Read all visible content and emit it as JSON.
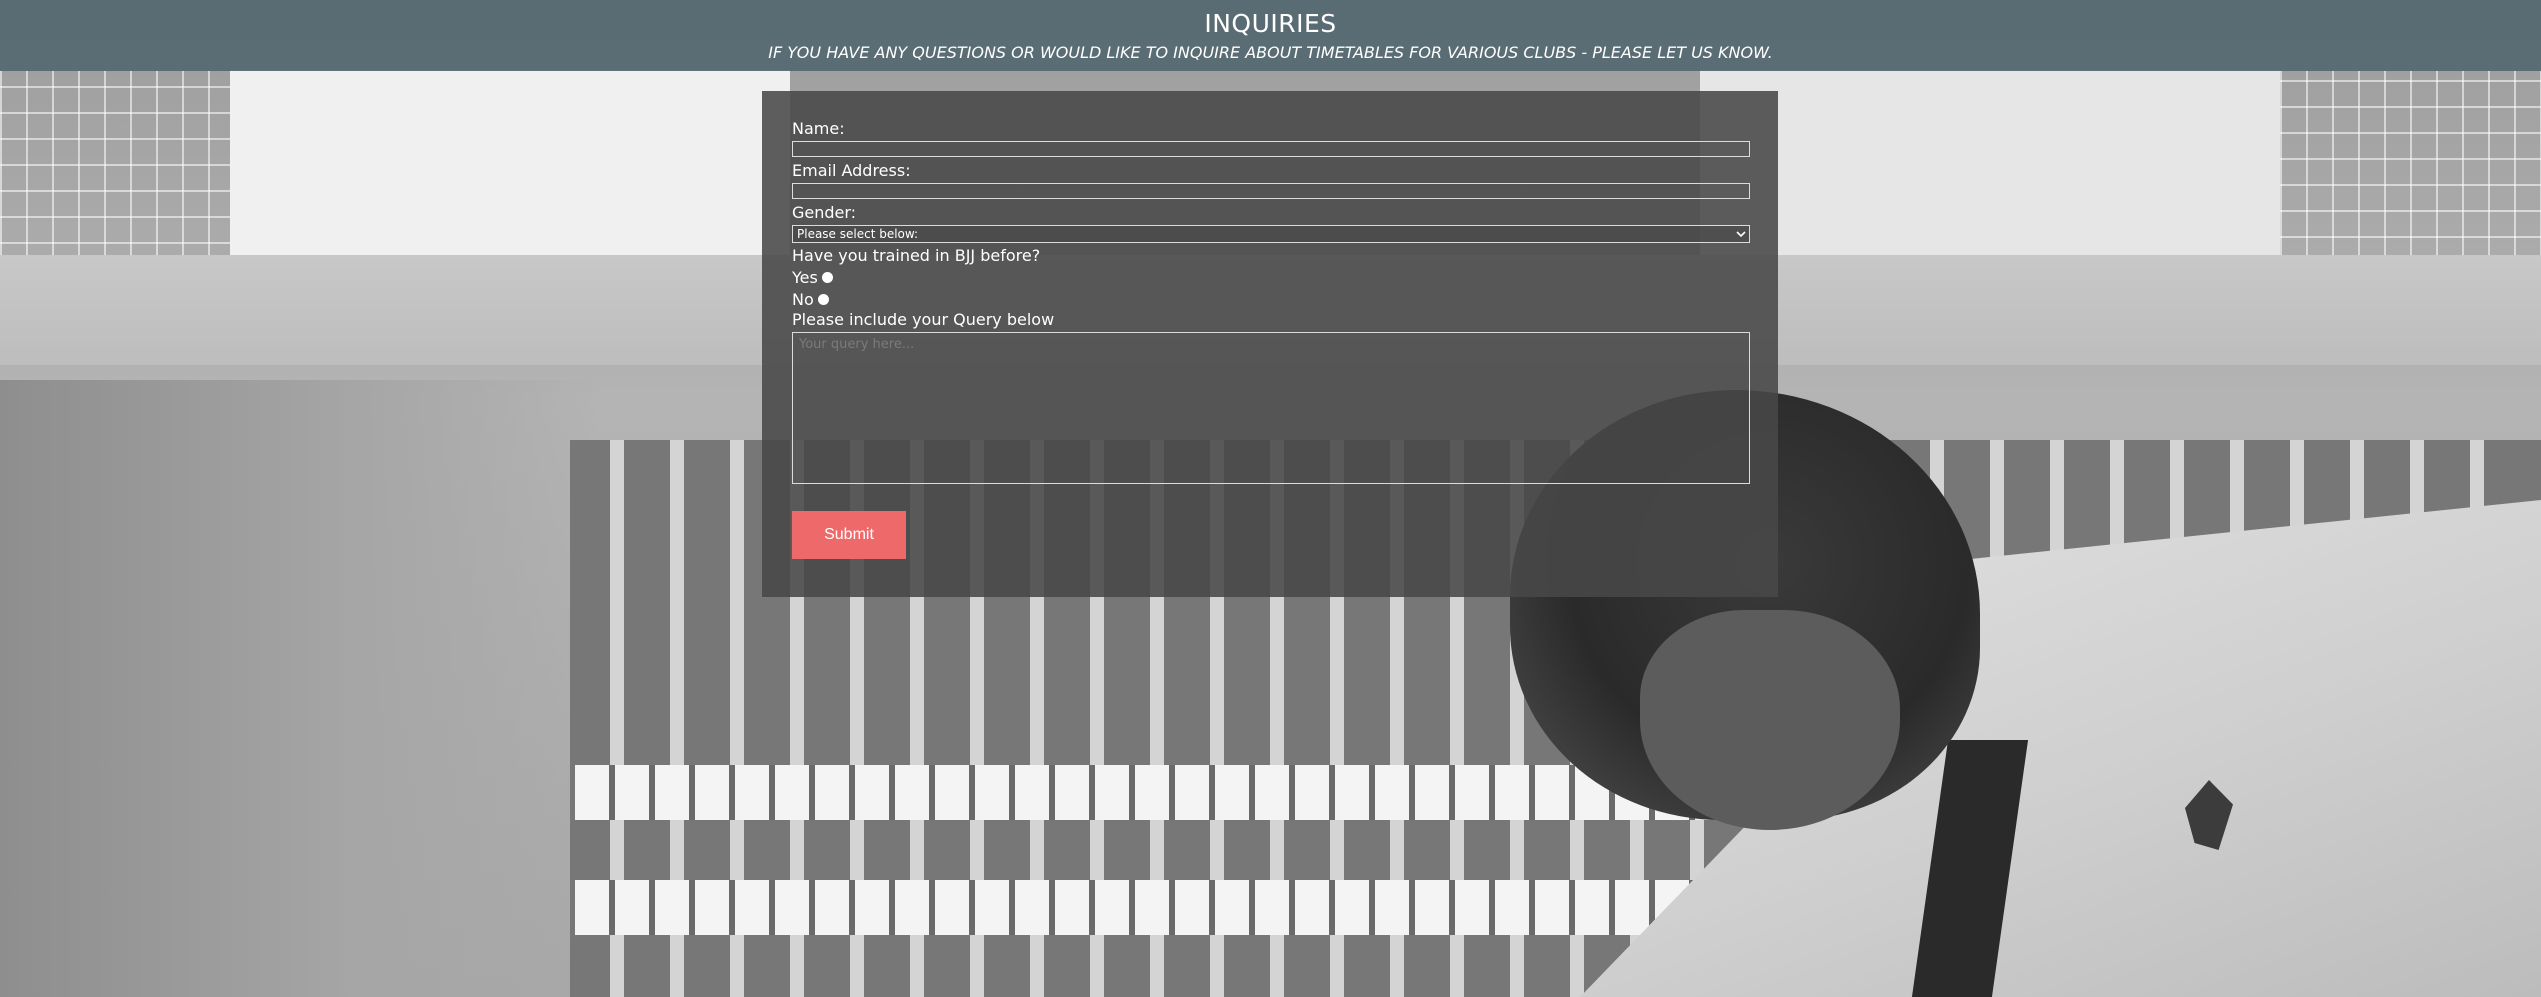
{
  "header": {
    "title": "INQUIRIES",
    "subtitle": "IF YOU HAVE ANY QUESTIONS OR WOULD LIKE TO INQUIRE ABOUT TIMETABLES FOR VARIOUS CLUBS - PLEASE LET US KNOW."
  },
  "form": {
    "name_label": "Name:",
    "name_value": "",
    "email_label": "Email Address:",
    "email_value": "",
    "gender_label": "Gender:",
    "gender_selected": "Please select below:",
    "trained_label": "Have you trained in BJJ before?",
    "radio_yes": "Yes",
    "radio_no": "No",
    "query_label": "Please include your Query below",
    "query_placeholder": "Your query here...",
    "submit_label": "Submit"
  },
  "colors": {
    "header_bg": "#546870",
    "panel_bg": "#484848",
    "submit_bg": "#ee6a6a"
  },
  "icons": {
    "select_arrow": "chevron-down-icon"
  }
}
